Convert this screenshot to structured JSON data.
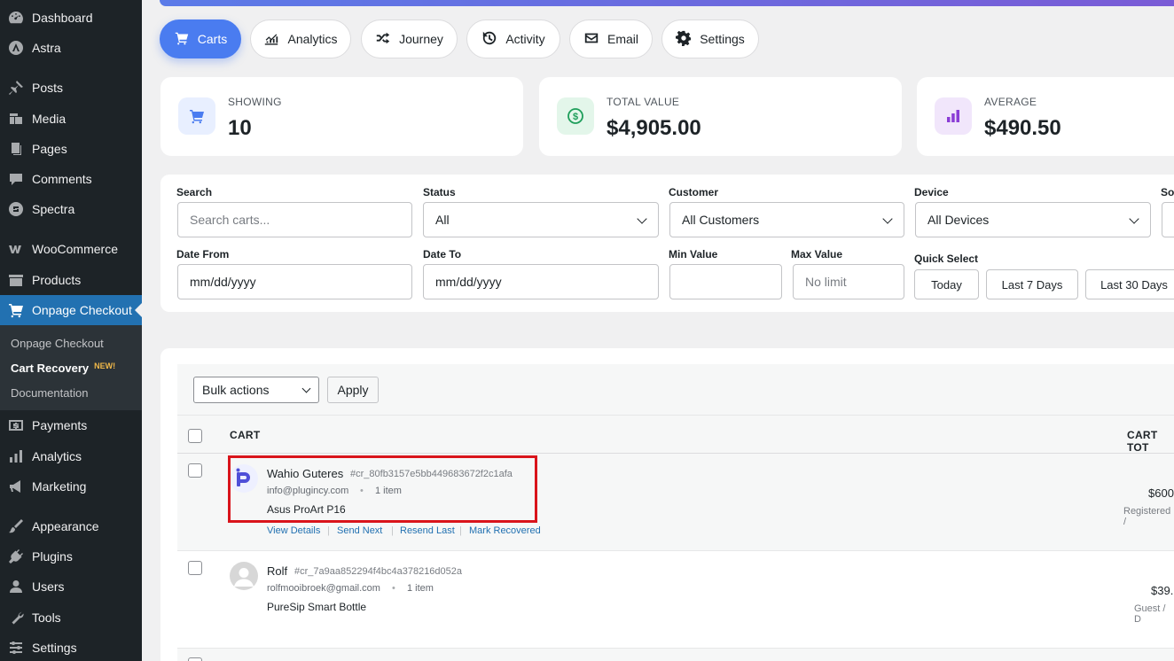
{
  "sidebar": {
    "items": [
      {
        "label": "Dashboard",
        "icon": "dashboard-icon"
      },
      {
        "label": "Astra",
        "icon": "astra-icon"
      },
      {
        "label": "Posts",
        "icon": "pin-icon"
      },
      {
        "label": "Media",
        "icon": "media-icon"
      },
      {
        "label": "Pages",
        "icon": "pages-icon"
      },
      {
        "label": "Comments",
        "icon": "comments-icon"
      },
      {
        "label": "Spectra",
        "icon": "spectra-icon"
      },
      {
        "label": "WooCommerce",
        "icon": "woocommerce-icon"
      },
      {
        "label": "Products",
        "icon": "products-icon"
      },
      {
        "label": "Onpage Checkout",
        "icon": "cart-icon"
      },
      {
        "label": "Payments",
        "icon": "payments-icon"
      },
      {
        "label": "Analytics",
        "icon": "analytics-icon"
      },
      {
        "label": "Marketing",
        "icon": "megaphone-icon"
      },
      {
        "label": "Appearance",
        "icon": "brush-icon"
      },
      {
        "label": "Plugins",
        "icon": "plugin-icon"
      },
      {
        "label": "Users",
        "icon": "user-icon"
      },
      {
        "label": "Tools",
        "icon": "wrench-icon"
      },
      {
        "label": "Settings",
        "icon": "settings-icon"
      }
    ],
    "submenu": [
      {
        "label": "Onpage Checkout"
      },
      {
        "label": "Cart Recovery",
        "badge": "NEW!"
      },
      {
        "label": "Documentation"
      }
    ]
  },
  "tabs": [
    {
      "label": "Carts",
      "icon": "cart-icon",
      "active": true
    },
    {
      "label": "Analytics",
      "icon": "chart-icon"
    },
    {
      "label": "Journey",
      "icon": "shuffle-icon"
    },
    {
      "label": "Activity",
      "icon": "history-icon"
    },
    {
      "label": "Email",
      "icon": "envelope-icon"
    },
    {
      "label": "Settings",
      "icon": "gear-icon"
    }
  ],
  "stats": [
    {
      "label": "SHOWING",
      "value": "10",
      "icon": "cart-icon",
      "color": "#4a7cf0",
      "bg": "#e8efff"
    },
    {
      "label": "TOTAL VALUE",
      "value": "$4,905.00",
      "icon": "dollar-icon",
      "color": "#1e9e5a",
      "bg": "#e3f6ea"
    },
    {
      "label": "AVERAGE",
      "value": "$490.50",
      "icon": "bar-chart-icon",
      "color": "#8b3dd6",
      "bg": "#f1e6fb"
    }
  ],
  "filters": {
    "search_label": "Search",
    "search_placeholder": "Search carts...",
    "status_label": "Status",
    "status_value": "All",
    "customer_label": "Customer",
    "customer_value": "All Customers",
    "device_label": "Device",
    "device_value": "All Devices",
    "source_label": "So",
    "date_from_label": "Date From",
    "date_from_placeholder": "mm/dd/yyyy",
    "date_to_label": "Date To",
    "date_to_placeholder": "mm/dd/yyyy",
    "min_label": "Min Value",
    "min_value": "",
    "max_label": "Max Value",
    "max_placeholder": "No limit",
    "quick_label": "Quick Select",
    "quick_options": [
      "Today",
      "Last 7 Days",
      "Last 30 Days"
    ]
  },
  "table": {
    "bulk_actions": "Bulk actions",
    "apply": "Apply",
    "col_cart": "CART",
    "col_total": "CART TOT",
    "rows": [
      {
        "name": "Wahio Guteres",
        "cart_id": "#cr_80fb3157e5bb449683672f2c1afa",
        "email": "info@plugincy.com",
        "dot": "•",
        "items": "1 item",
        "product": "Asus ProArt P16",
        "actions": [
          "View Details",
          "Send Next",
          "Resend Last",
          "Mark Recovered"
        ],
        "total": "$600",
        "note": "Registered /"
      },
      {
        "name": "Rolf",
        "cart_id": "#cr_7a9aa852294f4bc4a378216d052a",
        "email": "rolfmooibroek@gmail.com",
        "dot": "•",
        "items": "1 item",
        "product": "PureSip Smart Bottle",
        "total": "$39.",
        "note": "Guest / D"
      }
    ]
  },
  "colors": {
    "accent": "#4a7cf0",
    "sidebar_bg": "#1d2327",
    "sidebar_active": "#2271b1",
    "link": "#2271b1",
    "highlight": "#d9141b"
  }
}
